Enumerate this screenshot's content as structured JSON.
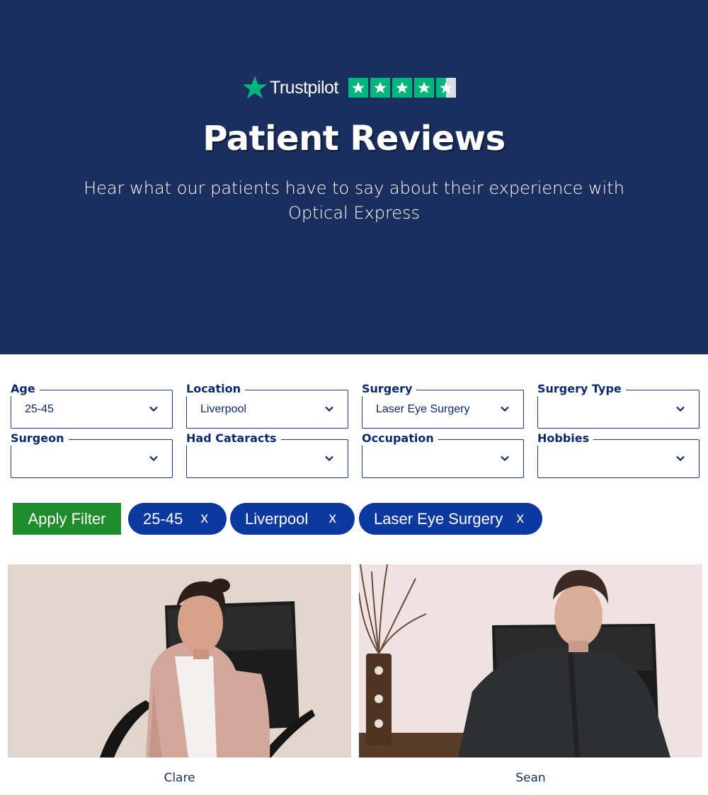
{
  "hero": {
    "brand": "Trustpilot",
    "rating_stars": 4.5,
    "title": "Patient Reviews",
    "subtitle": "Hear what our patients have to say about their experience with Optical Express"
  },
  "filters": [
    {
      "label": "Age",
      "value": "25-45"
    },
    {
      "label": "Location",
      "value": "Liverpool"
    },
    {
      "label": "Surgery",
      "value": "Laser Eye Surgery"
    },
    {
      "label": "Surgery Type",
      "value": ""
    },
    {
      "label": "Surgeon",
      "value": ""
    },
    {
      "label": "Had Cataracts",
      "value": ""
    },
    {
      "label": "Occupation",
      "value": ""
    },
    {
      "label": "Hobbies",
      "value": ""
    }
  ],
  "apply_label": "Apply Filter",
  "chips": [
    {
      "label": "25-45",
      "remove": "x"
    },
    {
      "label": "Liverpool",
      "remove": "x"
    },
    {
      "label": "Laser Eye Surgery",
      "remove": "x"
    }
  ],
  "videos": [
    {
      "name": "Clare"
    },
    {
      "name": "Sean"
    }
  ],
  "colors": {
    "hero_bg": "#1a2f5e",
    "trustpilot_green": "#00b67a",
    "apply_green": "#1e8c2a",
    "chip_blue": "#0b39a0",
    "text_navy": "#0b2a6e"
  }
}
